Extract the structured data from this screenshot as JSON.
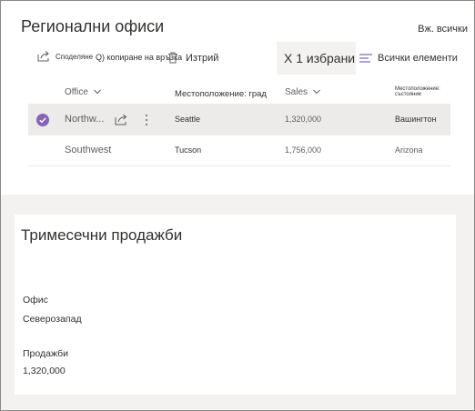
{
  "list": {
    "title": "Регионални офиси",
    "see_all": "Вж. всички",
    "commands": {
      "share": "Споделяне",
      "copy_link": "Q) копиране на връзка",
      "delete": "Изтрий",
      "selected": "X 1 избрани",
      "all_items": "Всички елементи"
    },
    "columns": {
      "office": "Office",
      "location_city": "Местоположение: град",
      "sales": "Sales",
      "location_state": "Местоположение: състояние"
    },
    "rows": [
      {
        "office": "Northw...",
        "city": "Seattle",
        "sales": "1,320,000",
        "state": "Вашингтон",
        "selected": true
      },
      {
        "office": "Southwest",
        "city": "Tucson",
        "sales": "1,756,000",
        "state": "Arizona",
        "selected": false
      }
    ]
  },
  "form": {
    "title": "Тримесечни продажби",
    "office_label": "Офис",
    "office_value": "Северозапад",
    "sales_label": "Продажби",
    "sales_value": "1,320,000"
  },
  "colors": {
    "accent": "#8764b8",
    "selected_row": "#edebe9",
    "page_background": "#f3f2f1"
  }
}
